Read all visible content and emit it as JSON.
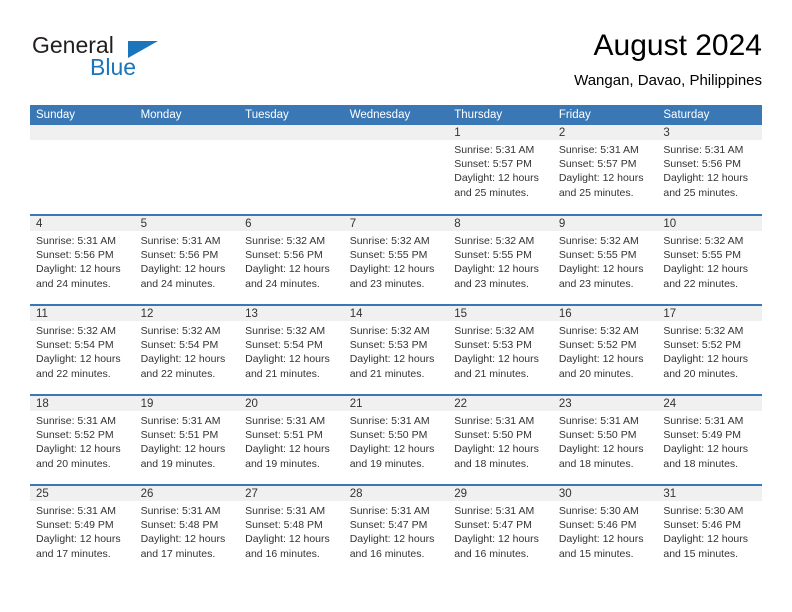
{
  "brand": {
    "name_part1": "General",
    "name_part2": "Blue",
    "accent_color": "#1b75bc",
    "triangle_icon": "triangle-icon"
  },
  "header": {
    "month_title": "August 2024",
    "location": "Wangan, Davao, Philippines"
  },
  "calendar": {
    "header_color": "#3a77b5",
    "daynum_band_color": "#f0f0f0",
    "weekday_headers": [
      "Sunday",
      "Monday",
      "Tuesday",
      "Wednesday",
      "Thursday",
      "Friday",
      "Saturday"
    ],
    "weeks": [
      [
        {
          "day": "",
          "empty": true
        },
        {
          "day": "",
          "empty": true
        },
        {
          "day": "",
          "empty": true
        },
        {
          "day": "",
          "empty": true
        },
        {
          "day": "1",
          "sunrise": "Sunrise: 5:31 AM",
          "sunset": "Sunset: 5:57 PM",
          "daylight_line1": "Daylight: 12 hours",
          "daylight_line2": "and 25 minutes."
        },
        {
          "day": "2",
          "sunrise": "Sunrise: 5:31 AM",
          "sunset": "Sunset: 5:57 PM",
          "daylight_line1": "Daylight: 12 hours",
          "daylight_line2": "and 25 minutes."
        },
        {
          "day": "3",
          "sunrise": "Sunrise: 5:31 AM",
          "sunset": "Sunset: 5:56 PM",
          "daylight_line1": "Daylight: 12 hours",
          "daylight_line2": "and 25 minutes."
        }
      ],
      [
        {
          "day": "4",
          "sunrise": "Sunrise: 5:31 AM",
          "sunset": "Sunset: 5:56 PM",
          "daylight_line1": "Daylight: 12 hours",
          "daylight_line2": "and 24 minutes."
        },
        {
          "day": "5",
          "sunrise": "Sunrise: 5:31 AM",
          "sunset": "Sunset: 5:56 PM",
          "daylight_line1": "Daylight: 12 hours",
          "daylight_line2": "and 24 minutes."
        },
        {
          "day": "6",
          "sunrise": "Sunrise: 5:32 AM",
          "sunset": "Sunset: 5:56 PM",
          "daylight_line1": "Daylight: 12 hours",
          "daylight_line2": "and 24 minutes."
        },
        {
          "day": "7",
          "sunrise": "Sunrise: 5:32 AM",
          "sunset": "Sunset: 5:55 PM",
          "daylight_line1": "Daylight: 12 hours",
          "daylight_line2": "and 23 minutes."
        },
        {
          "day": "8",
          "sunrise": "Sunrise: 5:32 AM",
          "sunset": "Sunset: 5:55 PM",
          "daylight_line1": "Daylight: 12 hours",
          "daylight_line2": "and 23 minutes."
        },
        {
          "day": "9",
          "sunrise": "Sunrise: 5:32 AM",
          "sunset": "Sunset: 5:55 PM",
          "daylight_line1": "Daylight: 12 hours",
          "daylight_line2": "and 23 minutes."
        },
        {
          "day": "10",
          "sunrise": "Sunrise: 5:32 AM",
          "sunset": "Sunset: 5:55 PM",
          "daylight_line1": "Daylight: 12 hours",
          "daylight_line2": "and 22 minutes."
        }
      ],
      [
        {
          "day": "11",
          "sunrise": "Sunrise: 5:32 AM",
          "sunset": "Sunset: 5:54 PM",
          "daylight_line1": "Daylight: 12 hours",
          "daylight_line2": "and 22 minutes."
        },
        {
          "day": "12",
          "sunrise": "Sunrise: 5:32 AM",
          "sunset": "Sunset: 5:54 PM",
          "daylight_line1": "Daylight: 12 hours",
          "daylight_line2": "and 22 minutes."
        },
        {
          "day": "13",
          "sunrise": "Sunrise: 5:32 AM",
          "sunset": "Sunset: 5:54 PM",
          "daylight_line1": "Daylight: 12 hours",
          "daylight_line2": "and 21 minutes."
        },
        {
          "day": "14",
          "sunrise": "Sunrise: 5:32 AM",
          "sunset": "Sunset: 5:53 PM",
          "daylight_line1": "Daylight: 12 hours",
          "daylight_line2": "and 21 minutes."
        },
        {
          "day": "15",
          "sunrise": "Sunrise: 5:32 AM",
          "sunset": "Sunset: 5:53 PM",
          "daylight_line1": "Daylight: 12 hours",
          "daylight_line2": "and 21 minutes."
        },
        {
          "day": "16",
          "sunrise": "Sunrise: 5:32 AM",
          "sunset": "Sunset: 5:52 PM",
          "daylight_line1": "Daylight: 12 hours",
          "daylight_line2": "and 20 minutes."
        },
        {
          "day": "17",
          "sunrise": "Sunrise: 5:32 AM",
          "sunset": "Sunset: 5:52 PM",
          "daylight_line1": "Daylight: 12 hours",
          "daylight_line2": "and 20 minutes."
        }
      ],
      [
        {
          "day": "18",
          "sunrise": "Sunrise: 5:31 AM",
          "sunset": "Sunset: 5:52 PM",
          "daylight_line1": "Daylight: 12 hours",
          "daylight_line2": "and 20 minutes."
        },
        {
          "day": "19",
          "sunrise": "Sunrise: 5:31 AM",
          "sunset": "Sunset: 5:51 PM",
          "daylight_line1": "Daylight: 12 hours",
          "daylight_line2": "and 19 minutes."
        },
        {
          "day": "20",
          "sunrise": "Sunrise: 5:31 AM",
          "sunset": "Sunset: 5:51 PM",
          "daylight_line1": "Daylight: 12 hours",
          "daylight_line2": "and 19 minutes."
        },
        {
          "day": "21",
          "sunrise": "Sunrise: 5:31 AM",
          "sunset": "Sunset: 5:50 PM",
          "daylight_line1": "Daylight: 12 hours",
          "daylight_line2": "and 19 minutes."
        },
        {
          "day": "22",
          "sunrise": "Sunrise: 5:31 AM",
          "sunset": "Sunset: 5:50 PM",
          "daylight_line1": "Daylight: 12 hours",
          "daylight_line2": "and 18 minutes."
        },
        {
          "day": "23",
          "sunrise": "Sunrise: 5:31 AM",
          "sunset": "Sunset: 5:50 PM",
          "daylight_line1": "Daylight: 12 hours",
          "daylight_line2": "and 18 minutes."
        },
        {
          "day": "24",
          "sunrise": "Sunrise: 5:31 AM",
          "sunset": "Sunset: 5:49 PM",
          "daylight_line1": "Daylight: 12 hours",
          "daylight_line2": "and 18 minutes."
        }
      ],
      [
        {
          "day": "25",
          "sunrise": "Sunrise: 5:31 AM",
          "sunset": "Sunset: 5:49 PM",
          "daylight_line1": "Daylight: 12 hours",
          "daylight_line2": "and 17 minutes."
        },
        {
          "day": "26",
          "sunrise": "Sunrise: 5:31 AM",
          "sunset": "Sunset: 5:48 PM",
          "daylight_line1": "Daylight: 12 hours",
          "daylight_line2": "and 17 minutes."
        },
        {
          "day": "27",
          "sunrise": "Sunrise: 5:31 AM",
          "sunset": "Sunset: 5:48 PM",
          "daylight_line1": "Daylight: 12 hours",
          "daylight_line2": "and 16 minutes."
        },
        {
          "day": "28",
          "sunrise": "Sunrise: 5:31 AM",
          "sunset": "Sunset: 5:47 PM",
          "daylight_line1": "Daylight: 12 hours",
          "daylight_line2": "and 16 minutes."
        },
        {
          "day": "29",
          "sunrise": "Sunrise: 5:31 AM",
          "sunset": "Sunset: 5:47 PM",
          "daylight_line1": "Daylight: 12 hours",
          "daylight_line2": "and 16 minutes."
        },
        {
          "day": "30",
          "sunrise": "Sunrise: 5:30 AM",
          "sunset": "Sunset: 5:46 PM",
          "daylight_line1": "Daylight: 12 hours",
          "daylight_line2": "and 15 minutes."
        },
        {
          "day": "31",
          "sunrise": "Sunrise: 5:30 AM",
          "sunset": "Sunset: 5:46 PM",
          "daylight_line1": "Daylight: 12 hours",
          "daylight_line2": "and 15 minutes."
        }
      ]
    ]
  }
}
